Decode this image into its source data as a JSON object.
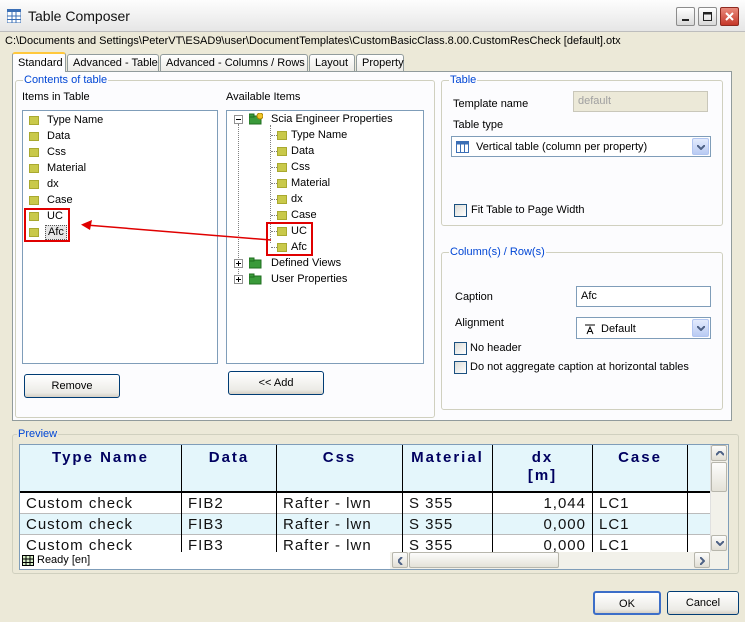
{
  "window": {
    "title": "Table Composer",
    "file_path": "C:\\Documents and Settings\\PeterVT\\ESAD9\\user\\DocumentTemplates\\CustomBasicClass.8.00.CustomResCheck [default].otx"
  },
  "tabs": [
    "Standard",
    "Advanced - Table",
    "Advanced - Columns / Rows",
    "Layout",
    "Property"
  ],
  "contents": {
    "group_title": "Contents of table",
    "items_label": "Items in Table",
    "items": [
      "Type Name",
      "Data",
      "Css",
      "Material",
      "dx",
      "Case",
      "UC",
      "Afc"
    ],
    "available_label": "Available Items",
    "tree_root": "Scia Engineer Properties",
    "tree_children": [
      "Type Name",
      "Data",
      "Css",
      "Material",
      "dx",
      "Case",
      "UC",
      "Afc"
    ],
    "tree_other": [
      "Defined Views",
      "User Properties"
    ],
    "remove_button": "Remove",
    "add_button": "<< Add"
  },
  "table_group": {
    "title": "Table",
    "template_name_label": "Template name",
    "template_name_value": "default",
    "table_type_label": "Table type",
    "table_type_value": "Vertical table (column per property)",
    "fit_label": "Fit Table to Page Width"
  },
  "colrow_group": {
    "title": "Column(s) / Row(s)",
    "caption_label": "Caption",
    "caption_value": "Afc",
    "alignment_label": "Alignment",
    "alignment_value": "Default",
    "no_header_label": "No header",
    "no_aggregate_label": "Do not aggregate caption at horizontal tables"
  },
  "preview": {
    "title": "Preview",
    "headers": [
      {
        "line1": "Type Name",
        "line2": ""
      },
      {
        "line1": "Data",
        "line2": ""
      },
      {
        "line1": "Css",
        "line2": ""
      },
      {
        "line1": "Material",
        "line2": ""
      },
      {
        "line1": "dx",
        "line2": "[m]"
      },
      {
        "line1": "Case",
        "line2": ""
      }
    ],
    "rows": [
      [
        "Custom check",
        "FIB2",
        "Rafter - lwn",
        "S 355",
        "1,044",
        "LC1"
      ],
      [
        "Custom check",
        "FIB3",
        "Rafter - lwn",
        "S 355",
        "0,000",
        "LC1"
      ],
      [
        "Custom check",
        "FIB3",
        "Rafter - lwn",
        "S 355",
        "0,000",
        "LC1"
      ]
    ],
    "status": "Ready [en]"
  },
  "footer": {
    "ok": "OK",
    "cancel": "Cancel"
  },
  "colors": {
    "accent_blue": "#0046d5",
    "annotation_red": "#e00000",
    "item_square": "#c9c94a",
    "header_bg": "#e4f6fb"
  }
}
